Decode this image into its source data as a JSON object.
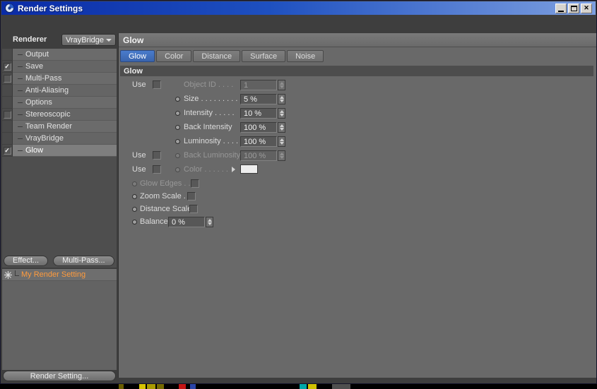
{
  "window": {
    "title": "Render Settings"
  },
  "glyphs": {
    "check": "✓",
    "close": "✕"
  },
  "colors": {
    "accent_blue": "#3D6CB4",
    "selection_orange": "#FF9B3D",
    "titlebar_start": "#0A2BA6",
    "titlebar_end": "#7D9FE0"
  },
  "sidebar": {
    "renderer_label": "Renderer",
    "renderer_value": "VrayBridge",
    "items": [
      {
        "label": "Output"
      },
      {
        "label": "Save"
      },
      {
        "label": "Multi-Pass"
      },
      {
        "label": "Anti-Aliasing"
      },
      {
        "label": "Options"
      },
      {
        "label": "Stereoscopic"
      },
      {
        "label": "Team Render"
      },
      {
        "label": "VrayBridge"
      },
      {
        "label": "Glow"
      }
    ],
    "effect_button": "Effect...",
    "multipass_button": "Multi-Pass...",
    "my_render_setting": "My Render Setting",
    "render_setting_button": "Render Setting..."
  },
  "main": {
    "header": "Glow",
    "tabs": [
      {
        "label": "Glow"
      },
      {
        "label": "Color"
      },
      {
        "label": "Distance"
      },
      {
        "label": "Surface"
      },
      {
        "label": "Noise"
      }
    ],
    "section": "Glow",
    "params": {
      "use_label": "Use",
      "object_id": {
        "label": "Object ID . . . .",
        "value": "1"
      },
      "size": {
        "label": "Size . . . . . . . . .",
        "value": "5 %"
      },
      "intensity": {
        "label": "Intensity . . . . .",
        "value": "10 %"
      },
      "back_intensity": {
        "label": "Back Intensity",
        "value": "100 %"
      },
      "luminosity": {
        "label": "Luminosity . . . .",
        "value": "100 %"
      },
      "back_luminosity": {
        "label": "Back Luminosity",
        "value": "100 %"
      },
      "color": {
        "label": "Color . . . . . ."
      },
      "glow_edges": {
        "label": "Glow Edges . ."
      },
      "zoom_scale": {
        "label": "Zoom Scale . ."
      },
      "distance_scale": {
        "label": "Distance Scale"
      },
      "balance": {
        "label": "Balance",
        "value": "0 %"
      }
    }
  }
}
